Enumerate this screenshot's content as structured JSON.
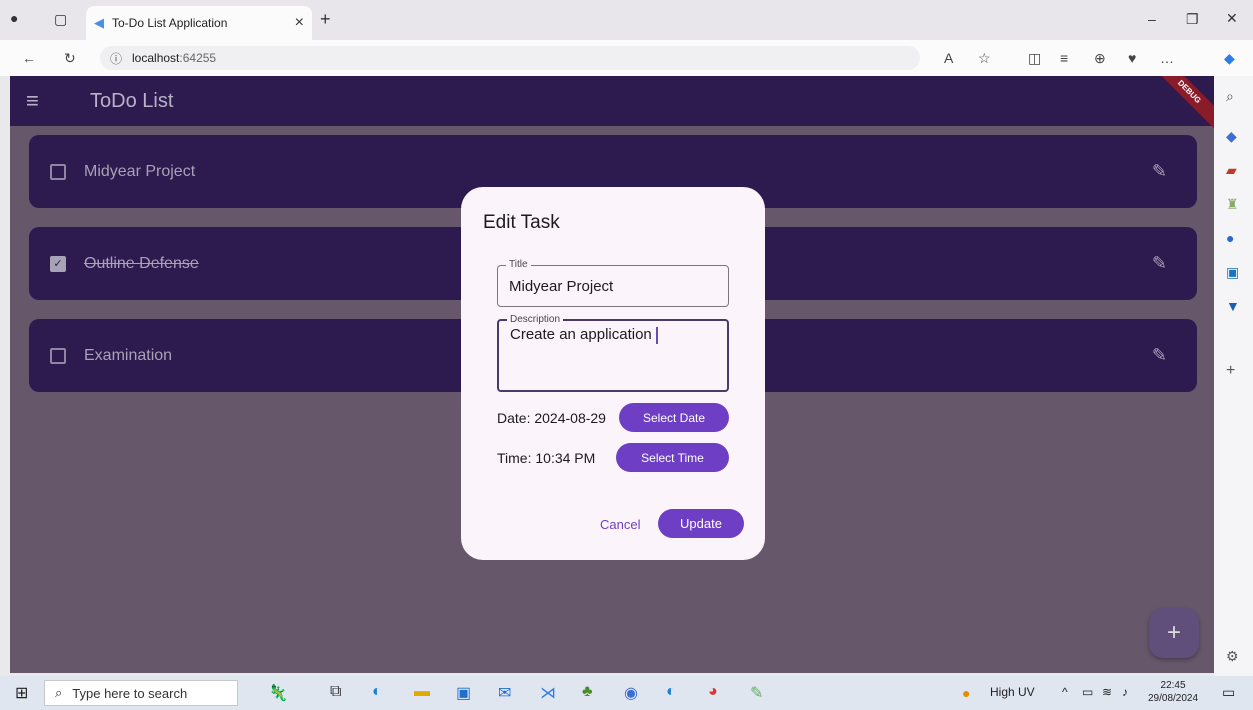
{
  "browser": {
    "tab_title": "To-Do List Application",
    "url_host": "localhost",
    "url_port": ":64255"
  },
  "app": {
    "title": "ToDo List",
    "debug_label": "DEBUG",
    "tasks": [
      {
        "label": "Midyear Project",
        "checked": false
      },
      {
        "label": "Outline Defense",
        "checked": true
      },
      {
        "label": "Examination",
        "checked": false
      }
    ],
    "fab_label": "+"
  },
  "dialog": {
    "title": "Edit Task",
    "title_field_label": "Title",
    "title_value": "Midyear Project",
    "description_label": "Description",
    "description_value": "Create an application",
    "date_text": "Date: 2024-08-29",
    "select_date_label": "Select Date",
    "time_text": "Time: 10:34 PM",
    "select_time_label": "Select Time",
    "cancel_label": "Cancel",
    "update_label": "Update"
  },
  "taskbar": {
    "search_placeholder": "Type here to search",
    "weather": "High UV",
    "time": "22:45",
    "date": "29/08/2024"
  }
}
